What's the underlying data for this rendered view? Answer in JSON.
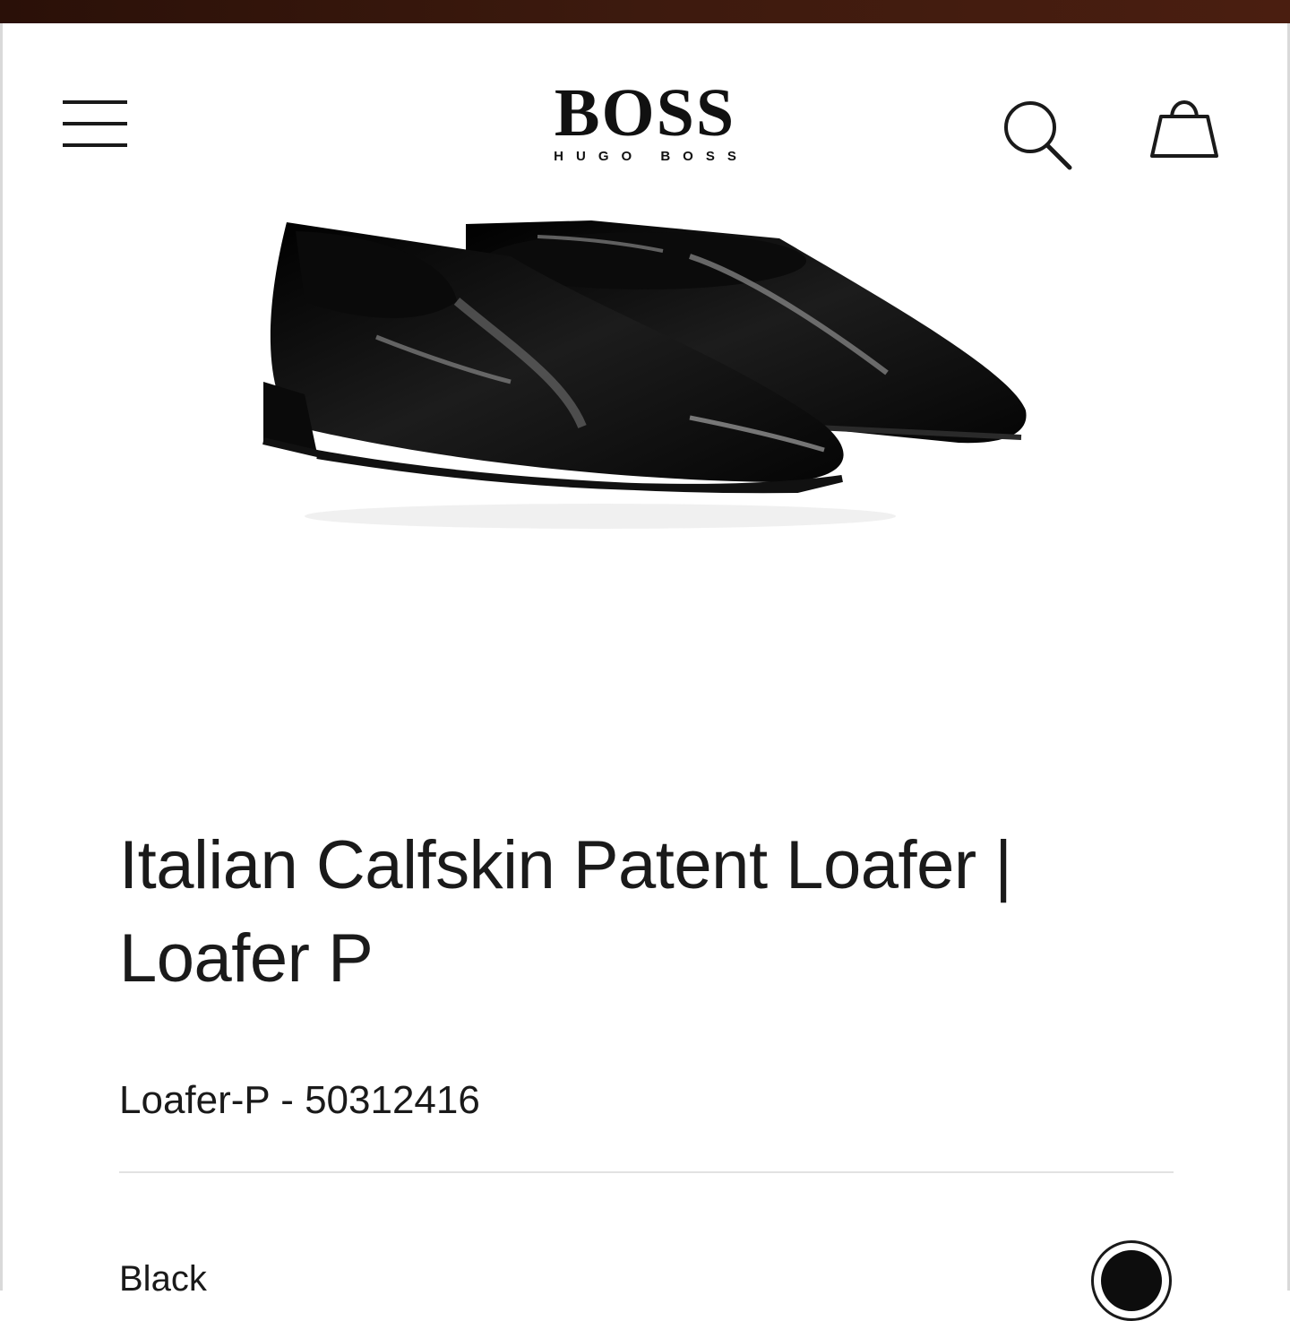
{
  "header": {
    "logo_main": "BOSS",
    "logo_sub": "HUGO BOSS",
    "menu_icon": "hamburger-menu-icon",
    "search_icon": "search-icon",
    "bag_icon": "shopping-bag-icon"
  },
  "product": {
    "title": "Italian Calfskin Patent Loafer | Loafer P",
    "sku": "Loafer-P - 50312416",
    "color_name": "Black",
    "color_hex": "#0d0d0d"
  },
  "colors": {
    "top_strip": "#3d1a0e",
    "text": "#1a1a1a",
    "divider": "#e2e2e2"
  }
}
